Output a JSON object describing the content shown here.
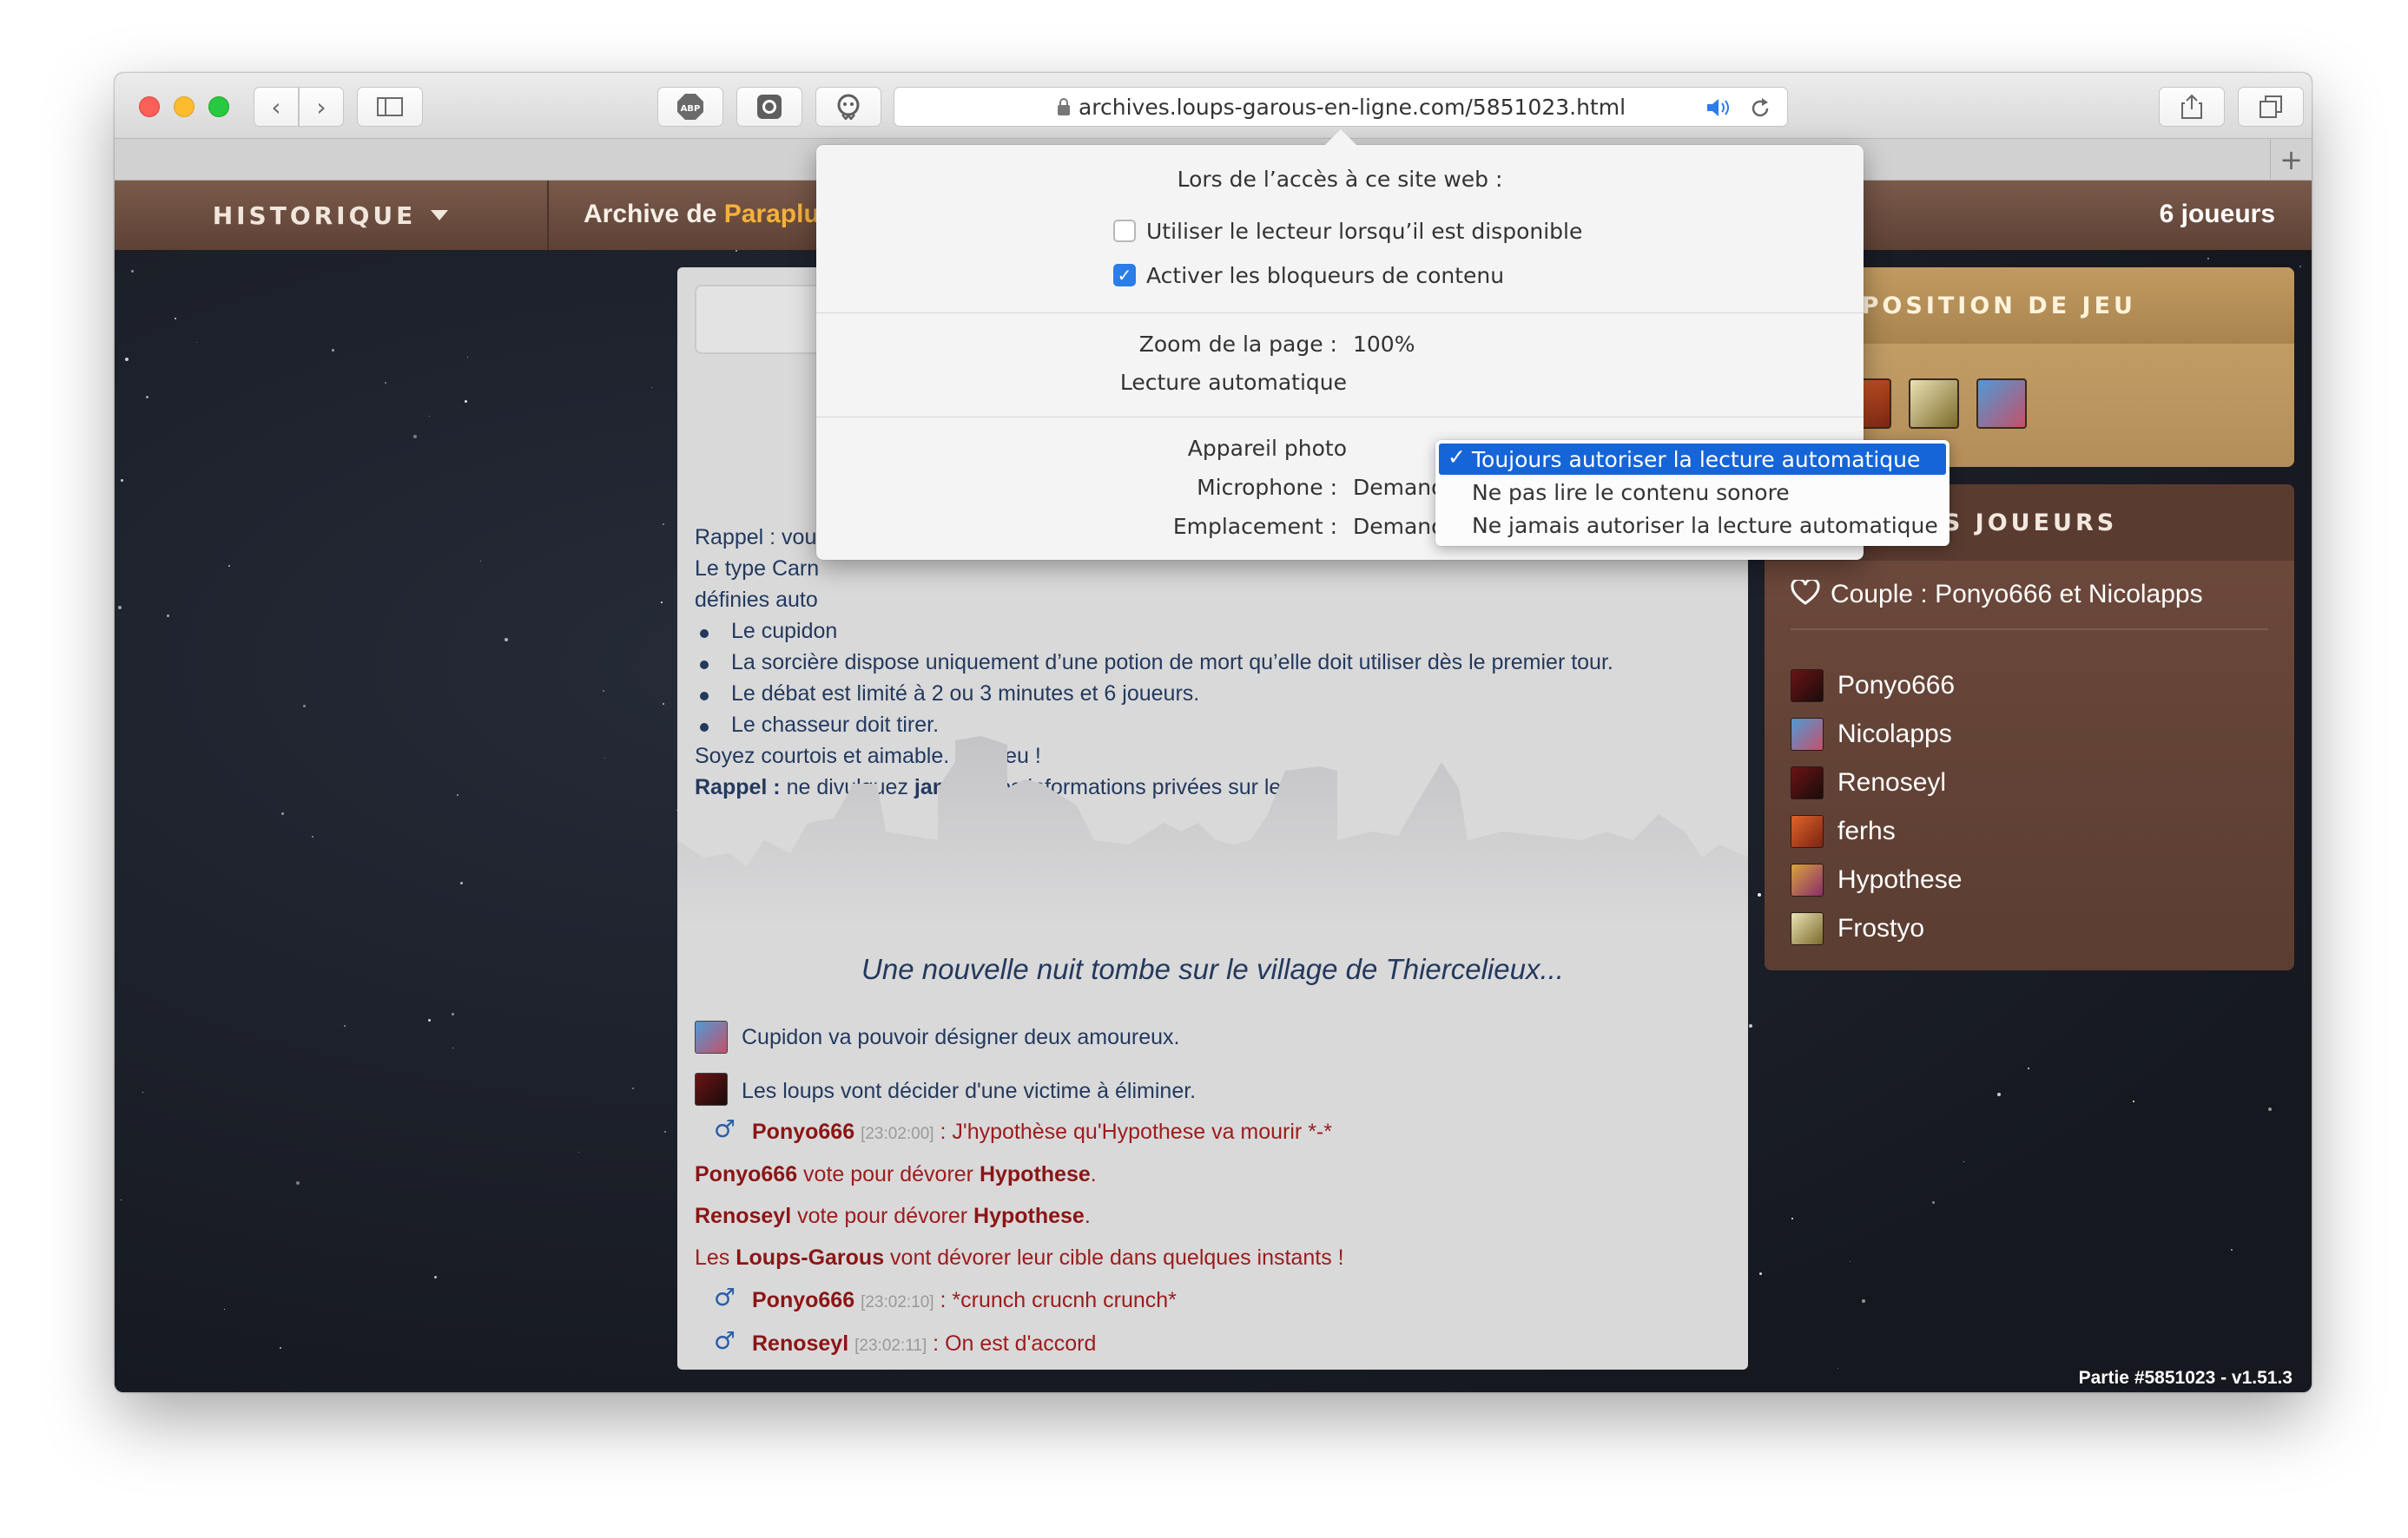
{
  "browser": {
    "url": "archives.loups-garous-en-ligne.com/5851023.html",
    "new_tab": "+"
  },
  "site": {
    "nav_history": "HISTORIQUE",
    "archive_prefix": "Archive de ",
    "archive_name": "Parapluie",
    "players_count": "6 joueurs",
    "version": "Partie #5851023 - v1.51.3"
  },
  "rules": {
    "line1": "Rappel : vous",
    "line2": "Le type Carn",
    "line3": "définies auto",
    "bullets": [
      "Le cupidon",
      "La sorcière dispose uniquement d’une potion de mort qu’elle doit utiliser dès le premier tour.",
      "Le débat est limité à 2 ou 3 minutes et 6 joueurs.",
      "Le chasseur doit tirer."
    ],
    "courtesy": "Soyez courtois et aimable. Bon jeu !",
    "reminder_label": "Rappel :",
    "reminder_text_1": " ne divulguez ",
    "reminder_bold": "jamais",
    "reminder_text_2": " vos informations privées sur le jeu."
  },
  "game": {
    "night_title": "Une nouvelle nuit tombe sur le village de Thiercelieux...",
    "events": [
      "Cupidon va pouvoir désigner deux amoureux.",
      "Les loups vont décider d'une victime à éliminer."
    ],
    "chat1": {
      "user": "Ponyo666",
      "time": "[23:02:00]",
      "text": " : J'hypothèse qu'Hypothese va mourir *-*"
    },
    "vote1": {
      "user": "Ponyo666",
      "text": " vote pour dévorer ",
      "target": "Hypothese",
      "end": "."
    },
    "vote2": {
      "user": "Renoseyl",
      "text": " vote pour dévorer ",
      "target": "Hypothese",
      "end": "."
    },
    "wolves": {
      "pre": "Les ",
      "bold": "Loups-Garous",
      "post": " vont dévorer leur cible dans quelques instants !"
    },
    "chat2": {
      "user": "Ponyo666",
      "time": "[23:02:10]",
      "text": " : *crunch crucnh crunch*"
    },
    "chat3": {
      "user": "Renoseyl",
      "time": "[23:02:11]",
      "text": " : On est d'accord"
    }
  },
  "composition": {
    "title": "COMPOSITION DE JEU"
  },
  "player_list": {
    "title": "LISTE DES JOUEURS",
    "couple": "Couple : Ponyo666 et Nicolapps",
    "players": [
      "Ponyo666",
      "Nicolapps",
      "Renoseyl",
      "ferhs",
      "Hypothese",
      "Frostyo"
    ]
  },
  "popover": {
    "header": "Lors de l’accès à ce site web :",
    "reader_label": "Utiliser le lecteur lorsqu’il est disponible",
    "blockers_label": "Activer les bloqueurs de contenu",
    "zoom_label": "Zoom de la page :",
    "zoom_value": "100%",
    "autoplay_label": "Lecture automatique",
    "camera_label": "Appareil photo",
    "microphone_label": "Microphone :",
    "microphone_value": "Demander",
    "location_label": "Emplacement :",
    "location_value": "Demander"
  },
  "autoplay_options": {
    "options": [
      "Toujours autoriser la lecture automatique",
      "Ne pas lire le contenu sonore",
      "Ne jamais autoriser la lecture automatique"
    ],
    "selected": "Toujours autoriser la lecture automatique",
    "check": "✓"
  },
  "colors": {
    "accent": "#1565d8",
    "night_text": "#23395d",
    "wolf_red": "#9b1c1c"
  }
}
